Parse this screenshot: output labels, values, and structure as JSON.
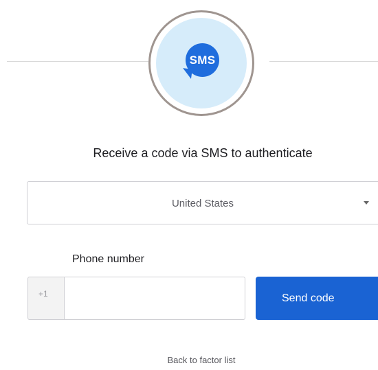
{
  "factor": {
    "icon": "sms-chat-bubble-icon",
    "icon_label": "SMS",
    "accent_color": "#1f6ddd",
    "circle_background": "#d6ecfa"
  },
  "title": "Receive a code via SMS to authenticate",
  "country_select": {
    "selected": "United States"
  },
  "phone": {
    "label": "Phone number",
    "country_code": "+1",
    "value": "",
    "placeholder": ""
  },
  "send_button": {
    "label": "Send code",
    "color": "#1a63d3"
  },
  "back_link": "Back to factor list"
}
